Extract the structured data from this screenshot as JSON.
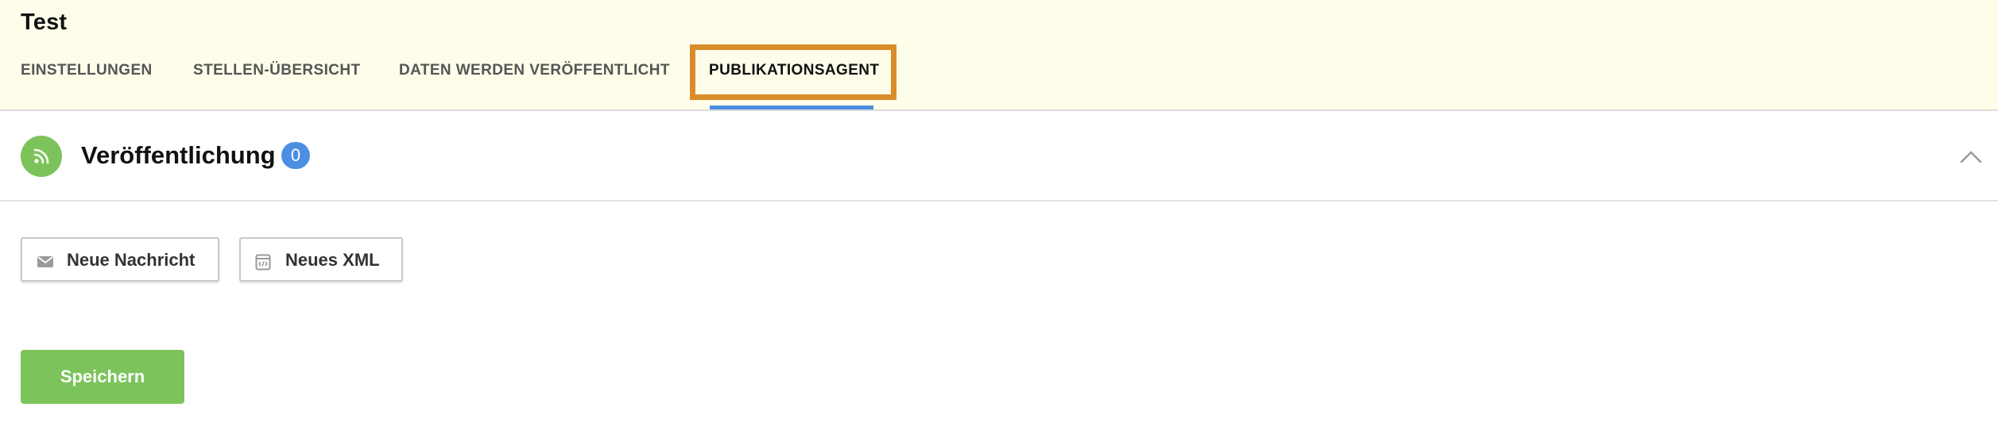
{
  "header": {
    "title": "Test",
    "tabs": [
      {
        "label": "EINSTELLUNGEN"
      },
      {
        "label": "STELLEN-ÜBERSICHT"
      },
      {
        "label": "DATEN WERDEN VERÖFFENTLICHT"
      },
      {
        "label": "PUBLIKATIONSAGENT"
      }
    ],
    "active_tab": "PUBLIKATIONSAGENT"
  },
  "section": {
    "icon": "rss-feed-icon",
    "title": "Veröffentlichung",
    "count": "0",
    "toggle_icon": "chevron-up-icon"
  },
  "actions": {
    "new_message": {
      "label": "Neue Nachricht",
      "icon": "envelope-icon"
    },
    "new_xml": {
      "label": "Neues XML",
      "icon": "xml-file-icon"
    }
  },
  "save_label": "Speichern",
  "colors": {
    "header_bg": "#fdfde9",
    "accent_blue": "#4b8fe2",
    "success_green": "#7cc35b",
    "highlight_orange": "#d98c2b"
  }
}
